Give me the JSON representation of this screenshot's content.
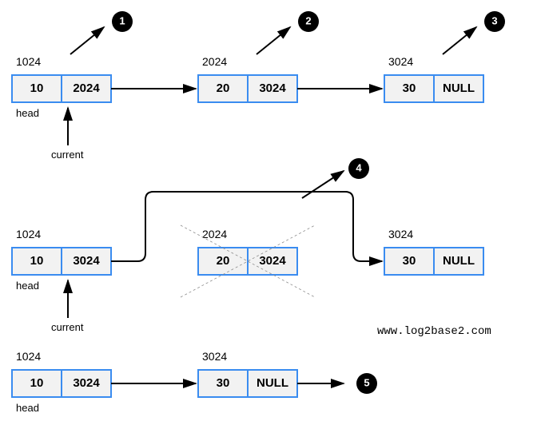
{
  "watermark": "www.log2base2.com",
  "labels": {
    "head": "head",
    "current": "current"
  },
  "row1": {
    "nodes": [
      {
        "addr": "1024",
        "data": "10",
        "next": "2024"
      },
      {
        "addr": "2024",
        "data": "20",
        "next": "3024"
      },
      {
        "addr": "3024",
        "data": "30",
        "next": "NULL"
      }
    ],
    "badges": [
      "1",
      "2",
      "3"
    ]
  },
  "row2": {
    "nodes": [
      {
        "addr": "1024",
        "data": "10",
        "next": "3024"
      },
      {
        "addr": "2024",
        "data": "20",
        "next": "3024"
      },
      {
        "addr": "3024",
        "data": "30",
        "next": "NULL"
      }
    ],
    "badges": [
      "4"
    ]
  },
  "row3": {
    "nodes": [
      {
        "addr": "1024",
        "data": "10",
        "next": "3024"
      },
      {
        "addr": "3024",
        "data": "30",
        "next": "NULL"
      }
    ],
    "badges": [
      "5"
    ]
  }
}
